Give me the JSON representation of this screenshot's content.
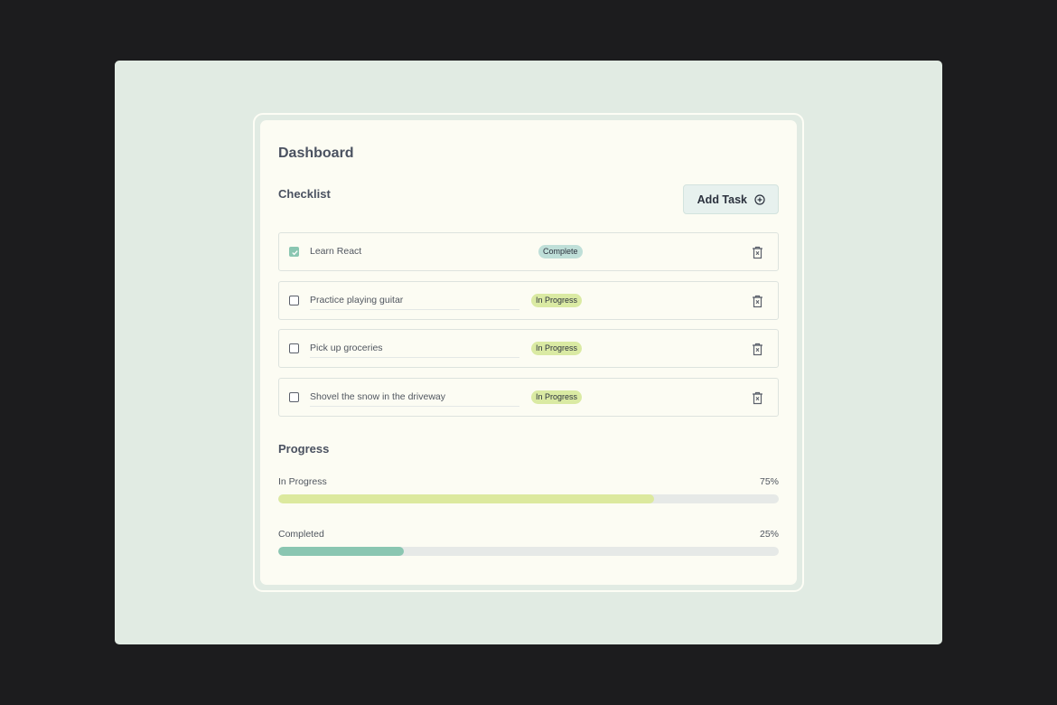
{
  "dashboard": {
    "title": "Dashboard"
  },
  "checklist": {
    "title": "Checklist",
    "add_button_label": "Add Task",
    "tasks": [
      {
        "label": "Learn React",
        "checked": true,
        "status": "Complete"
      },
      {
        "label": "Practice playing guitar",
        "checked": false,
        "status": "In Progress"
      },
      {
        "label": "Pick up groceries",
        "checked": false,
        "status": "In Progress"
      },
      {
        "label": "Shovel the snow in the driveway",
        "checked": false,
        "status": "In Progress"
      }
    ]
  },
  "progress": {
    "title": "Progress",
    "bars": [
      {
        "label": "In Progress",
        "value_text": "75%",
        "value": 75,
        "color": "#dce99e"
      },
      {
        "label": "Completed",
        "value_text": "25%",
        "value": 25,
        "color": "#8ac6b1"
      }
    ]
  },
  "icons": {
    "add": "plus-circle-icon",
    "delete": "trash-icon",
    "check": "check-icon"
  }
}
